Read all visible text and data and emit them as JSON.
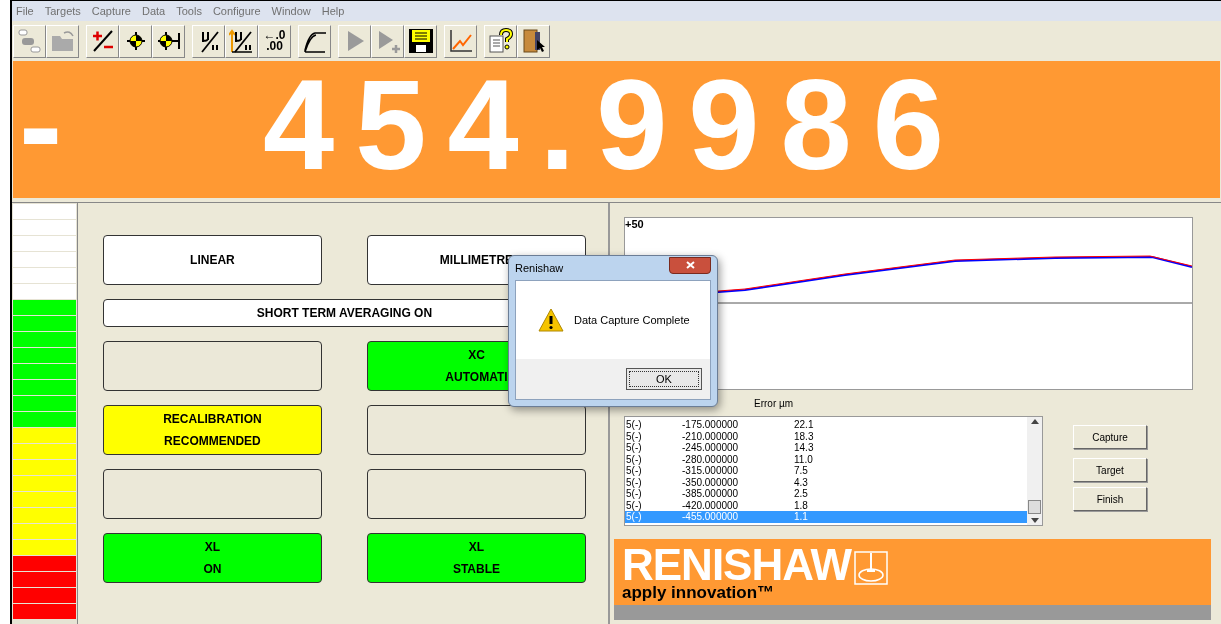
{
  "menu": [
    "File",
    "Targets",
    "Capture",
    "Data",
    "Tools",
    "Configure",
    "Window",
    "Help"
  ],
  "toolbar": [
    {
      "kind": "sequence"
    },
    {
      "kind": "open"
    },
    {
      "kind": "plusminus"
    },
    {
      "kind": "target"
    },
    {
      "kind": "target-datum"
    },
    {
      "kind": "mu"
    },
    {
      "kind": "mu-up"
    },
    {
      "kind": "resolution",
      "lines": [
        "←.0",
        ".00"
      ]
    },
    {
      "kind": "curve"
    },
    {
      "kind": "play"
    },
    {
      "kind": "play-add"
    },
    {
      "kind": "save"
    },
    {
      "kind": "graph"
    },
    {
      "kind": "help"
    },
    {
      "kind": "exit"
    }
  ],
  "display": {
    "sign": "-",
    "value": "454.9986"
  },
  "meter": [
    {
      "color": "#ffffff"
    },
    {
      "color": "#ffffff"
    },
    {
      "color": "#ffffff"
    },
    {
      "color": "#ffffff"
    },
    {
      "color": "#ffffff"
    },
    {
      "color": "#ffffff"
    },
    {
      "color": "#00ff00"
    },
    {
      "color": "#00ff00"
    },
    {
      "color": "#00ff00"
    },
    {
      "color": "#00ff00"
    },
    {
      "color": "#00ff00"
    },
    {
      "color": "#00ff00"
    },
    {
      "color": "#00ff00"
    },
    {
      "color": "#00ff00"
    },
    {
      "color": "#ffff00"
    },
    {
      "color": "#ffff00"
    },
    {
      "color": "#ffff00"
    },
    {
      "color": "#ffff00"
    },
    {
      "color": "#ffff00"
    },
    {
      "color": "#ffff00"
    },
    {
      "color": "#ffff00"
    },
    {
      "color": "#ffff00"
    },
    {
      "color": "#ff0000"
    },
    {
      "color": "#ff0000"
    },
    {
      "color": "#ff0000"
    },
    {
      "color": "#ff0000"
    }
  ],
  "status_tiles": [
    {
      "color": "#ffffff",
      "lines": [
        "LINEAR"
      ]
    },
    {
      "color": "#ffffff",
      "lines": [
        "MILLIMETRE"
      ]
    },
    {
      "color": "#ffffff",
      "lines": [
        "SHORT TERM AVERAGING ON"
      ],
      "wide": true
    },
    {
      "color": "#ebe8d8"
    },
    {
      "color": "#00ff00",
      "lines": [
        "XC",
        "AUTOMATI"
      ]
    },
    {
      "color": "#ffff00",
      "lines": [
        "RECALIBRATION",
        "RECOMMENDED"
      ]
    },
    {
      "color": "#ebe8d8"
    },
    {
      "color": "#ebe8d8"
    },
    {
      "color": "#ebe8d8"
    },
    {
      "color": "#00ff00",
      "lines": [
        "XL",
        "ON"
      ]
    },
    {
      "color": "#00ff00",
      "lines": [
        "XL",
        "STABLE"
      ]
    }
  ],
  "chart": {
    "label": "+50"
  },
  "table": {
    "columns": [
      "Error µm"
    ],
    "rows": [
      {
        "cells": [
          "5(-)",
          "-175.000000",
          "22.1"
        ],
        "selected": false
      },
      {
        "cells": [
          "5(-)",
          "-210.000000",
          "18.3"
        ],
        "selected": false
      },
      {
        "cells": [
          "5(-)",
          "-245.000000",
          "14.3"
        ],
        "selected": false
      },
      {
        "cells": [
          "5(-)",
          "-280.000000",
          "11.0"
        ],
        "selected": false
      },
      {
        "cells": [
          "5(-)",
          "-315.000000",
          "7.5"
        ],
        "selected": false
      },
      {
        "cells": [
          "5(-)",
          "-350.000000",
          "4.3"
        ],
        "selected": false
      },
      {
        "cells": [
          "5(-)",
          "-385.000000",
          "2.5"
        ],
        "selected": false
      },
      {
        "cells": [
          "5(-)",
          "-420.000000",
          "1.8"
        ],
        "selected": false
      },
      {
        "cells": [
          "5(-)",
          "-455.000000",
          "1.1"
        ],
        "selected": true
      }
    ]
  },
  "buttons": [
    "Capture",
    "Target",
    "Finish"
  ],
  "logo": {
    "name": "RENISHAW",
    "tagline": "apply innovation™"
  },
  "dialog": {
    "title": "Renishaw",
    "message": "Data Capture Complete",
    "button": "OK"
  }
}
